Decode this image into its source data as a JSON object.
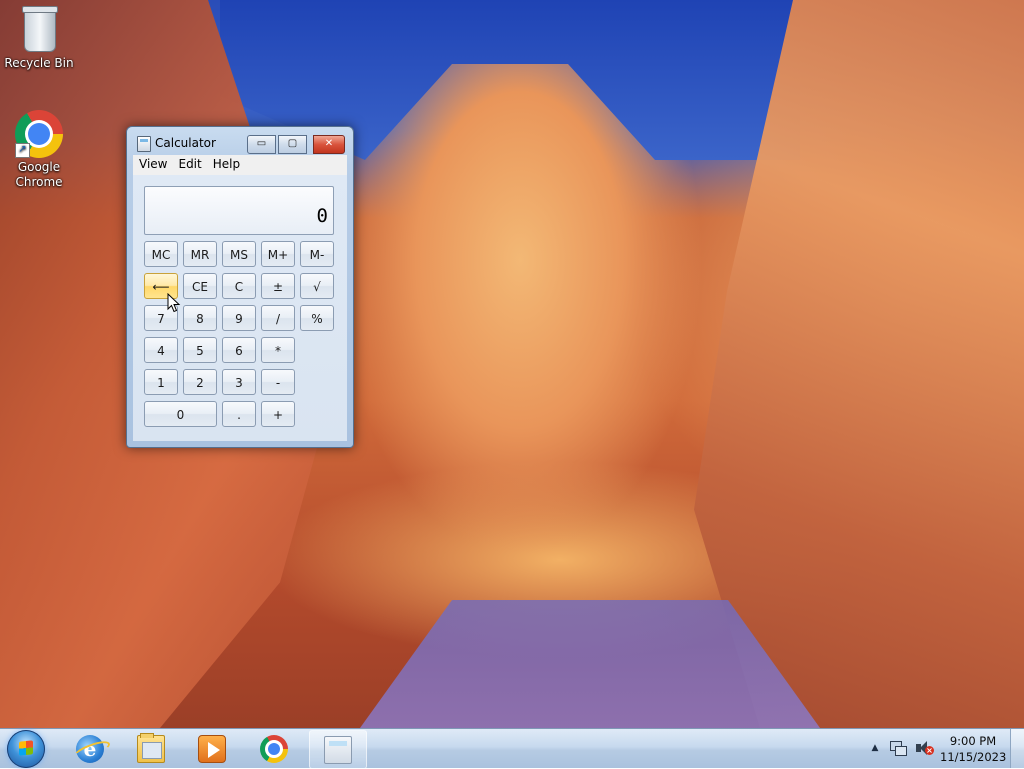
{
  "desktop": {
    "icons": [
      {
        "label": "Recycle Bin",
        "icon": "recycle-bin-icon"
      },
      {
        "label": "Google Chrome",
        "icon": "chrome-icon"
      }
    ]
  },
  "calculator": {
    "title": "Calculator",
    "caption_buttons": {
      "minimize": "▭",
      "maximize": "▢",
      "close": "✕"
    },
    "menu": [
      "View",
      "Edit",
      "Help"
    ],
    "display": "0",
    "keys": {
      "mc": "MC",
      "mr": "MR",
      "ms": "MS",
      "mplus": "M+",
      "mminus": "M-",
      "backspace": "⟵",
      "ce": "CE",
      "c": "C",
      "plusminus": "±",
      "sqrt": "√",
      "seven": "7",
      "eight": "8",
      "nine": "9",
      "divide": "/",
      "percent": "%",
      "four": "4",
      "five": "5",
      "six": "6",
      "multiply": "*",
      "reciprocal": "",
      "one": "1",
      "two": "2",
      "three": "3",
      "subtract": "-",
      "equals": "",
      "zero": "0",
      "decimal": ".",
      "add": "+"
    }
  },
  "taskbar": {
    "pinned": [
      "Internet Explorer",
      "Windows Explorer",
      "Windows Media Player",
      "Google Chrome",
      "Calculator"
    ],
    "tray": {
      "overflow": "▲",
      "mute_badge": "×"
    },
    "clock": {
      "time": "9:00 PM",
      "date": "11/15/2023"
    }
  },
  "colors": {
    "taskbar": "#bcd0e7",
    "calculator_frame": "#b7cde7",
    "hover_key": "#ffe9a8",
    "close_button": "#d9543d"
  }
}
